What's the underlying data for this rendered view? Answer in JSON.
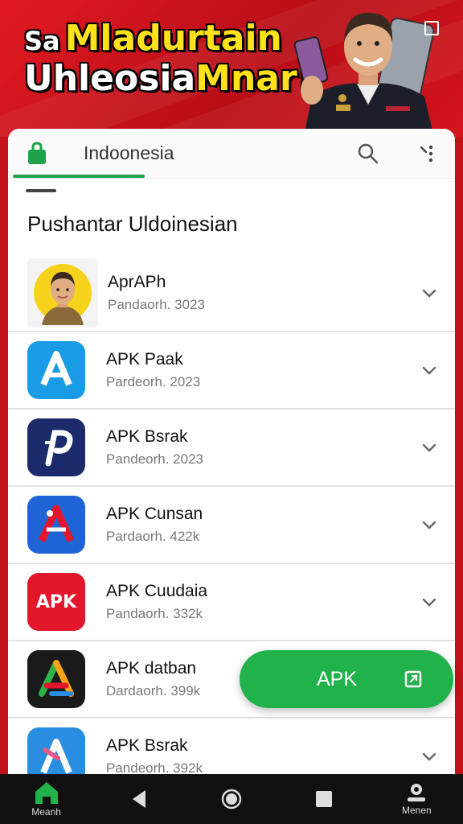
{
  "banner": {
    "prefix": "Sa",
    "line1": "Mladurtain",
    "line2_white": "Uhleosia",
    "line2_yellow": "Mnar!",
    "accent_red": "#e21a22",
    "accent_yellow": "#ffe21a"
  },
  "topbar": {
    "store_icon": "shopping-bag-icon",
    "tab_label": "Indoonesia",
    "search_icon": "search-icon",
    "more_icon": "more-vertical-icon",
    "accent_green": "#1fa34a"
  },
  "section": {
    "title": "Pushantar Uldoinesian"
  },
  "apps": [
    {
      "name": "AprAPh",
      "meta": "Pandaorh. 3023",
      "icon": "avatar-portrait-icon"
    },
    {
      "name": "APK Paak",
      "meta": "Pardeorh. 2023",
      "icon": "app-a-blue-icon",
      "color": "#1a9be6"
    },
    {
      "name": "APK Bsrak",
      "meta": "Pandeorh. 2023",
      "icon": "app-p-navy-icon",
      "color": "#1b2a6b"
    },
    {
      "name": "APK Cunsan",
      "meta": "Pardaorh. 422k",
      "icon": "app-a-red-blue-icon",
      "color": "#1f64d6"
    },
    {
      "name": "APK Cuudaia",
      "meta": "Pandaorh. 332k",
      "icon": "apk-red-icon",
      "color": "#e3172b",
      "icon_text": "APK"
    },
    {
      "name": "APK datban",
      "meta": "Dardaorh. 399k",
      "icon": "app-a-multicolor-icon",
      "color": "#1a1a1a"
    },
    {
      "name": "APK Bsrak",
      "meta": "Pandeorh. 392k",
      "icon": "app-a-pink-blue-icon",
      "color": "#2a8ee0"
    }
  ],
  "fab": {
    "label": "APK",
    "icon": "open-external-icon",
    "color": "#22b24c"
  },
  "bottom_nav": {
    "home_label": "Meanh",
    "home_icon": "home-icon",
    "back_icon": "back-triangle-icon",
    "home_circle_icon": "home-circle-icon",
    "recents_icon": "recents-square-icon",
    "profile_label": "Menen",
    "profile_icon": "profile-icon"
  }
}
